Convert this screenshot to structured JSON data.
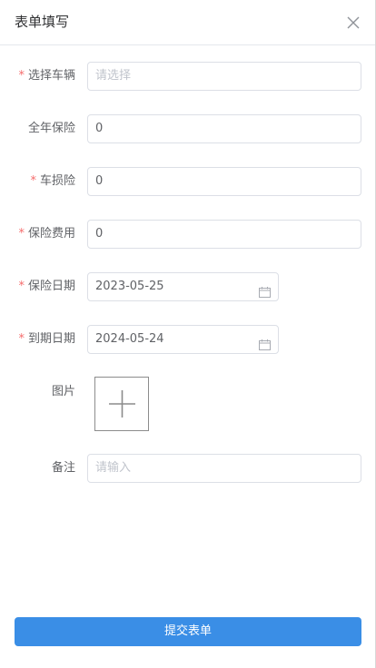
{
  "header": {
    "title": "表单填写",
    "close_icon": "close-icon"
  },
  "form": {
    "vehicle": {
      "label": "选择车辆",
      "required": true,
      "placeholder": "请选择"
    },
    "annual_insurance": {
      "label": "全年保险",
      "required": false,
      "value": "0"
    },
    "vehicle_damage": {
      "label": "车损险",
      "required": true,
      "value": "0"
    },
    "insurance_fee": {
      "label": "保险费用",
      "required": true,
      "value": "0"
    },
    "insurance_date": {
      "label": "保险日期",
      "required": true,
      "value": "2023-05-25",
      "icon": "calendar-icon"
    },
    "expiry_date": {
      "label": "到期日期",
      "required": true,
      "value": "2024-05-24",
      "icon": "calendar-icon"
    },
    "image": {
      "label": "图片",
      "required": false,
      "icon": "plus-icon"
    },
    "remark": {
      "label": "备注",
      "required": false,
      "placeholder": "请输入"
    }
  },
  "submit_label": "提交表单",
  "colors": {
    "primary": "#3a8ee6",
    "required_mark": "#f56c6c",
    "border": "#dcdfe6"
  }
}
